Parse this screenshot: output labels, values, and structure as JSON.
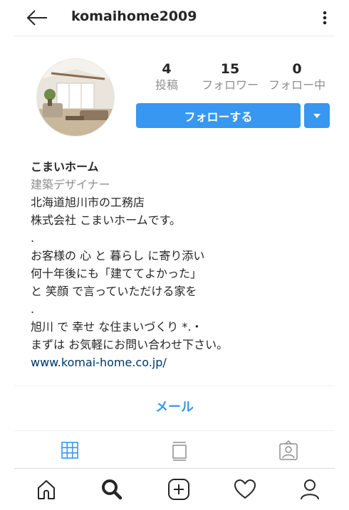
{
  "header": {
    "title": "komaihome2009",
    "back_icon": "arrow-left-icon",
    "more_icon": "vertical-dots-icon"
  },
  "profile": {
    "avatar_alt": "profile-photo",
    "stats": [
      {
        "num": "4",
        "label": "投稿"
      },
      {
        "num": "15",
        "label": "フォロワー"
      },
      {
        "num": "0",
        "label": "フォロー中"
      }
    ],
    "follow_label": "フォローする",
    "accent_color": "#3897f0"
  },
  "bio": {
    "name": "こまいホーム",
    "category": "建築デザイナー",
    "lines": [
      "北海道旭川市の工務店",
      "株式会社 こまいホームです。",
      ".",
      "お客様の 心 と 暮らし に寄り添い",
      "何十年後にも「建ててよかった」",
      "と 笑顔 で言っていただける家を",
      ".",
      "旭川 で 幸せ な住まいづくり *.・",
      "まずは お気軽にお問い合わせ下さい。"
    ],
    "link": "www.komai-home.co.jp/"
  },
  "actions": {
    "email_label": "メール"
  },
  "tabs": [
    "grid-icon",
    "feed-icon",
    "tagged-icon"
  ],
  "bottom_nav": [
    "home-icon",
    "search-icon",
    "add-post-icon",
    "heart-icon",
    "profile-icon"
  ]
}
